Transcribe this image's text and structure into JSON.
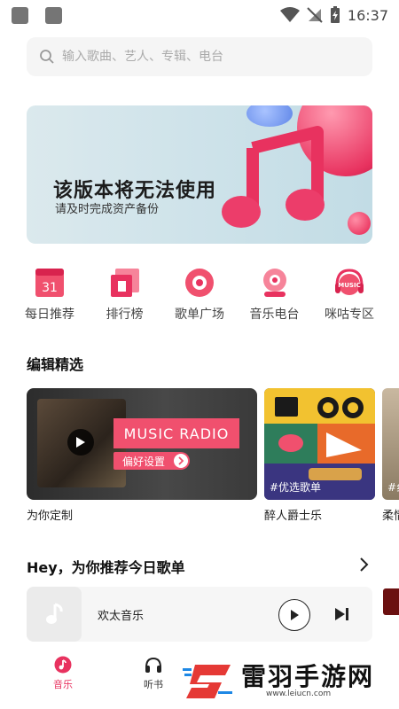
{
  "status_bar": {
    "time": "16:37"
  },
  "search": {
    "placeholder": "输入歌曲、艺人、专辑、电台"
  },
  "banner": {
    "title": "该版本将无法使用",
    "subtitle": "请及时完成资产备份"
  },
  "nav": [
    {
      "label": "每日推荐",
      "icon": "calendar-icon",
      "badge": "31"
    },
    {
      "label": "排行榜",
      "icon": "chart-icon"
    },
    {
      "label": "歌单广场",
      "icon": "playlist-disc-icon"
    },
    {
      "label": "音乐电台",
      "icon": "radio-icon"
    },
    {
      "label": "咪咕专区",
      "icon": "headphones-icon",
      "badge": "MUSIC"
    }
  ],
  "editor_section": {
    "title": "编辑精选"
  },
  "cards": [
    {
      "tag": "MUSIC RADIO",
      "pref_label": "偏好设置",
      "caption": "为你定制"
    },
    {
      "tag": "#优选歌单",
      "caption": "醉人爵士乐"
    },
    {
      "tag": "#纟",
      "caption": "柔情"
    }
  ],
  "recommend": {
    "title": "Hey，为你推荐今日歌单",
    "item_name": "欢太音乐"
  },
  "tabs": [
    {
      "label": "音乐"
    },
    {
      "label": "听书"
    }
  ],
  "watermark": {
    "name": "雷羽手游网",
    "url": "www.leiucn.com"
  },
  "colors": {
    "accent": "#e8325f",
    "tag_pink": "#f0506e"
  }
}
